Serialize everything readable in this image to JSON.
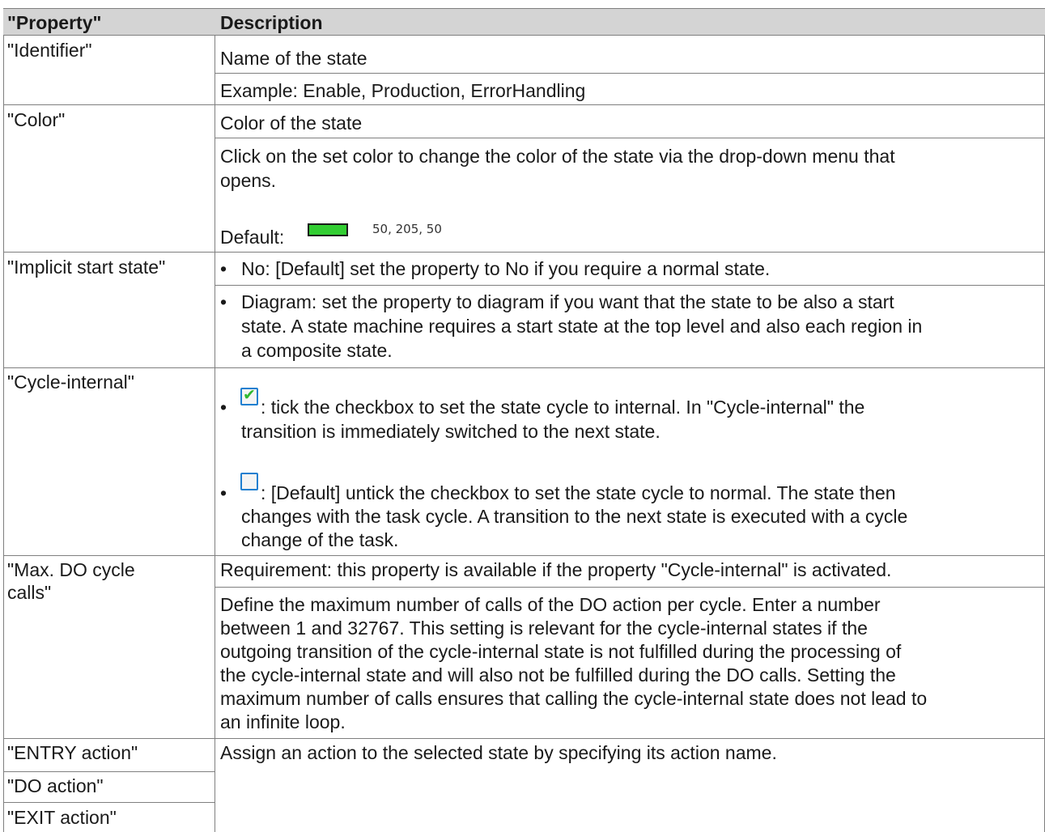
{
  "header": {
    "col1": "\"Property\"",
    "col2": "Description"
  },
  "identifier": {
    "name": "\"Identifier\"",
    "line1": "Name of the state",
    "line2": "Example: Enable, Production, ErrorHandling"
  },
  "color": {
    "name": "\"Color\"",
    "line1": "Color of the state",
    "line2a": "Click on the set color to change the color of the state via the drop-down menu that",
    "line2b": "opens.",
    "default_label": "Default:",
    "swatch_hex": "#32cd32",
    "rgb_text": "50, 205, 50"
  },
  "implicit": {
    "name": "\"Implicit start state\"",
    "b1": "No: [Default] set the property to No if you require a normal state.",
    "b2a": "Diagram: set the property to diagram if you want that the state to be also a start",
    "b2b": "state. A state machine requires a start state at the top level and also each region in",
    "b2c": "a composite state."
  },
  "cycle": {
    "name": "\"Cycle-internal\"",
    "checked_icon": "checkbox-checked-icon",
    "unchecked_icon": "checkbox-unchecked-icon",
    "b1a": ": tick the checkbox to set the state cycle to internal. In \"Cycle-internal\" the",
    "b1b": "transition is immediately switched to the next state.",
    "b2a": ": [Default] untick the checkbox to set the state cycle to normal. The state then",
    "b2b": "changes with the task cycle. A transition to the next state is executed with a cycle",
    "b2c": "change of the task."
  },
  "maxdo": {
    "name_a": "\"Max. DO cycle",
    "name_b": "calls\"",
    "line1": "Requirement: this property is available if the property \"Cycle-internal\" is activated.",
    "p1": "Define the maximum number of calls of the DO action per cycle. Enter a number",
    "p2": "between 1 and 32767. This setting is relevant for the cycle-internal states if the",
    "p3": "outgoing transition of the cycle-internal state is not fulfilled during the processing of",
    "p4": "the cycle-internal state and will also not be fulfilled during the DO calls. Setting the",
    "p5": "maximum number of calls ensures that calling the cycle-internal state does not lead to",
    "p6": "an infinite loop."
  },
  "actions": {
    "entry": "\"ENTRY action\"",
    "do": "\"DO action\"",
    "exit": "\"EXIT action\"",
    "desc": "Assign an action to the selected state by specifying its action name."
  }
}
